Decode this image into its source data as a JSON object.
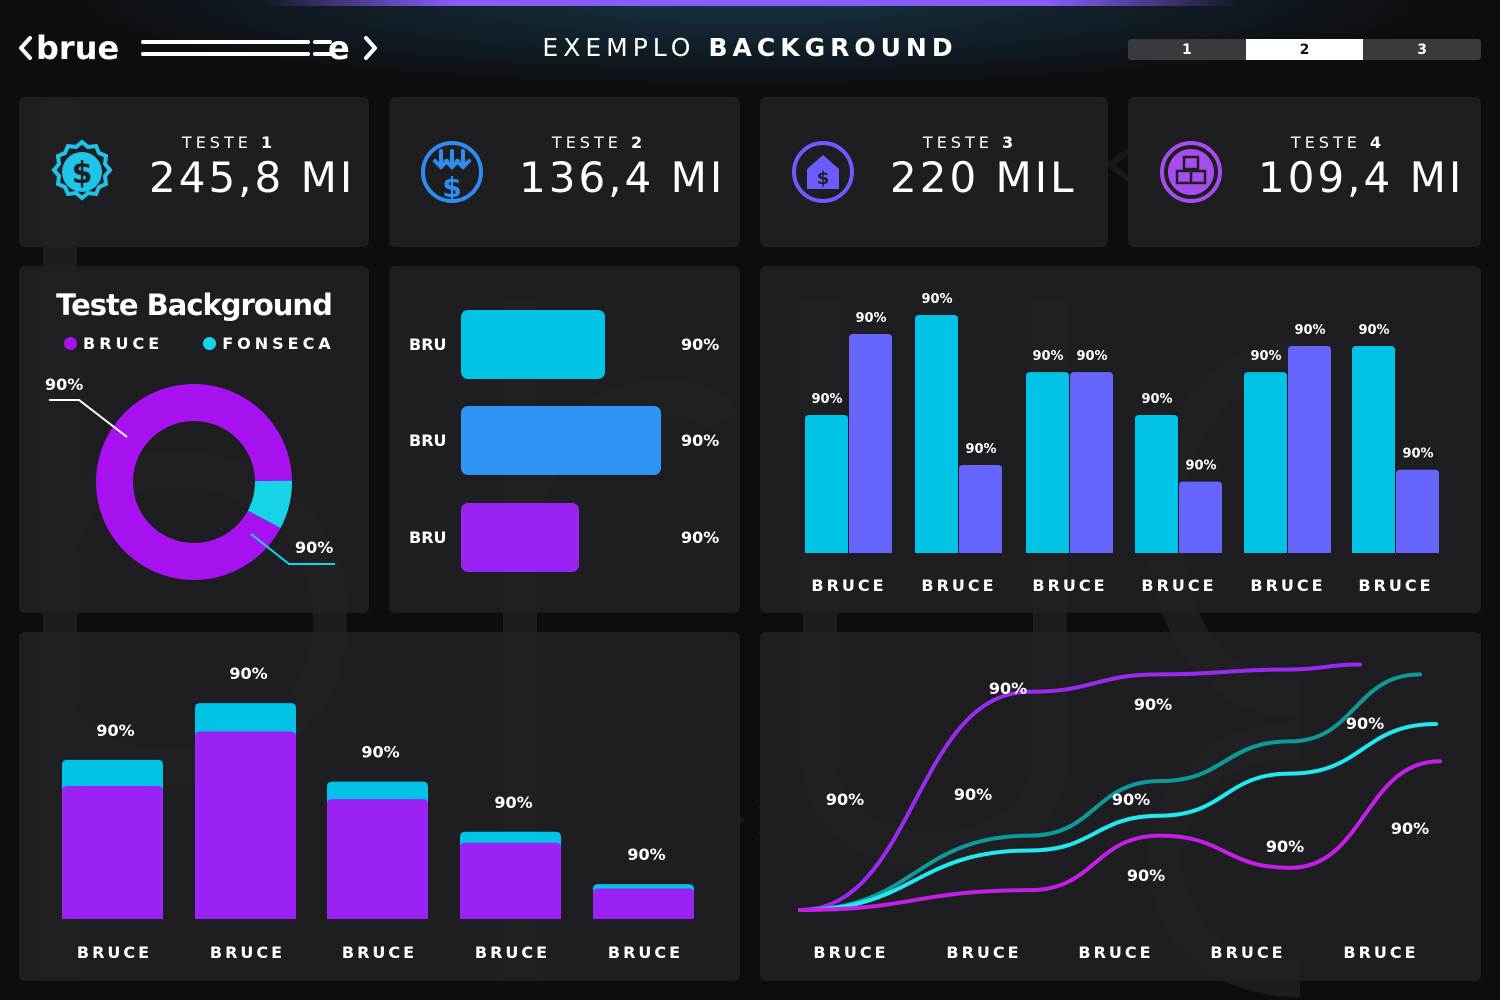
{
  "header": {
    "logo_text": "brue",
    "title_light": "EXEMPLO",
    "title_bold": "BACKGROUND",
    "pages": [
      "1",
      "2",
      "3"
    ],
    "active_page": "2"
  },
  "kpis": [
    {
      "label": "TESTE",
      "number": "1",
      "value": "245,8 MI",
      "icon": "dollar-badge-icon",
      "color": "#1fc4e8"
    },
    {
      "label": "TESTE",
      "number": "2",
      "value": "136,4 MI",
      "icon": "dollar-down-arrows-icon",
      "color": "#2f8cf0"
    },
    {
      "label": "TESTE",
      "number": "3",
      "value": "220 MIL",
      "icon": "house-dollar-icon",
      "color": "#6a5cff"
    },
    {
      "label": "TESTE",
      "number": "4",
      "value": "109,4 MI",
      "icon": "boxes-icon",
      "color": "#a84cf0"
    }
  ],
  "donut": {
    "title": "Teste Background",
    "legend": [
      {
        "name": "BRUCE",
        "color": "#a811f0"
      },
      {
        "name": "FONSECA",
        "color": "#15d4e8"
      }
    ]
  },
  "colors": {
    "cyan": "#00c3e6",
    "blue": "#2e95f5",
    "violet": "#9a22f5",
    "indigo": "#6666ff",
    "teal": "#0f9a9a",
    "aqua": "#22e8f0",
    "magenta": "#c41ee8",
    "purple_line": "#9a2af0"
  },
  "chart_data": [
    {
      "type": "pie",
      "title": "Teste Background",
      "categories": [
        "BRUCE",
        "FONSECA"
      ],
      "values": [
        92,
        8
      ],
      "labels": [
        "90%",
        "90%"
      ],
      "legend": "top"
    },
    {
      "type": "bar",
      "orientation": "horizontal",
      "categories": [
        "BRU",
        "BRU",
        "BRU"
      ],
      "values": [
        72,
        100,
        59
      ],
      "labels": [
        "90%",
        "90%",
        "90%"
      ]
    },
    {
      "type": "bar",
      "categories": [
        "BRUCE",
        "BRUCE",
        "BRUCE",
        "BRUCE",
        "BRUCE",
        "BRUCE"
      ],
      "series": [
        {
          "values": [
            58,
            100,
            76,
            58,
            76,
            87
          ],
          "labels": [
            "90%",
            "90%",
            "90%",
            "90%",
            "90%",
            "90%"
          ]
        },
        {
          "values": [
            92,
            37,
            76,
            30,
            87,
            35
          ],
          "labels": [
            "90%",
            "90%",
            "90%",
            "90%",
            "90%",
            "90%"
          ]
        }
      ]
    },
    {
      "type": "bar",
      "stacked": true,
      "categories": [
        "BRUCE",
        "BRUCE",
        "BRUCE",
        "BRUCE",
        "BRUCE"
      ],
      "series": [
        {
          "values": [
            61,
            86,
            55,
            35,
            14
          ]
        },
        {
          "values": [
            12,
            13,
            8,
            5,
            2
          ]
        }
      ],
      "labels": [
        "90%",
        "90%",
        "90%",
        "90%",
        "90%"
      ]
    },
    {
      "type": "line",
      "categories": [
        "BRUCE",
        "BRUCE",
        "BRUCE",
        "BRUCE",
        "BRUCE"
      ],
      "series": [
        {
          "values": [
            0,
            88,
            95,
            97,
            99
          ]
        },
        {
          "values": [
            0,
            30,
            52,
            68,
            95
          ]
        },
        {
          "values": [
            0,
            24,
            38,
            55,
            75
          ]
        },
        {
          "values": [
            0,
            8,
            30,
            17,
            60
          ]
        }
      ],
      "labels": [
        "90%",
        "90%",
        "90%",
        "90%",
        "90%",
        "90%",
        "90%",
        "90%",
        "90%"
      ]
    }
  ]
}
